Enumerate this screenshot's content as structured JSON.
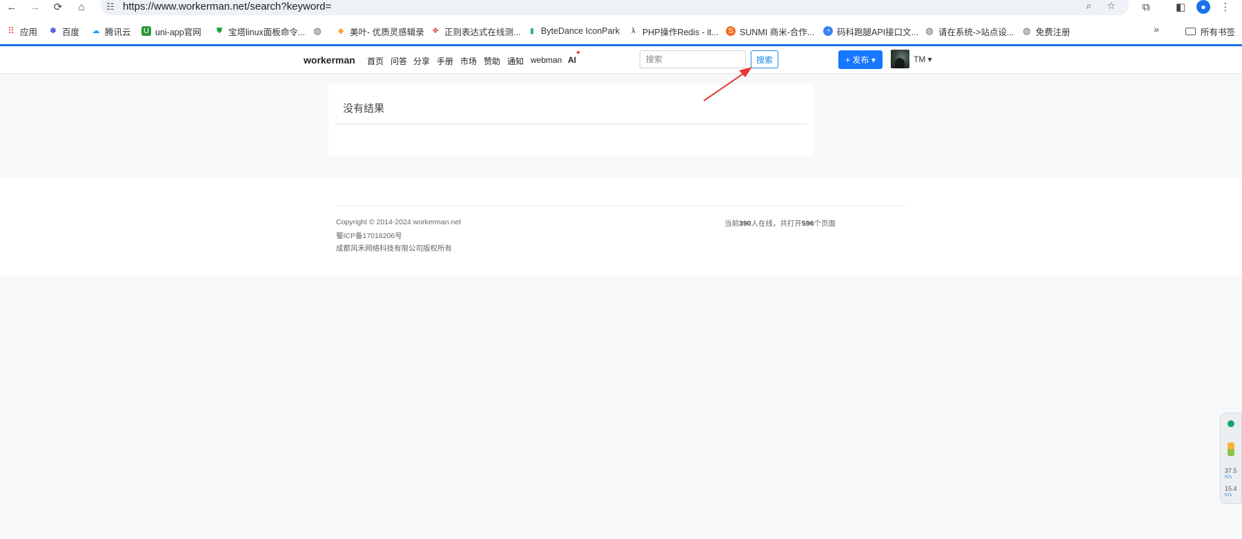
{
  "browser": {
    "url": "https://www.workerman.net/search?keyword=",
    "bookmarks": [
      {
        "label": "应用",
        "icon": "apps-grid-icon",
        "color": "#e8453c"
      },
      {
        "label": "百度",
        "icon": "baidu-paw-icon",
        "color": "#2932e1"
      },
      {
        "label": "腾讯云",
        "icon": "cloud-icon",
        "color": "#00a3ff"
      },
      {
        "label": "uni-app官网",
        "icon": "uni-app-icon",
        "color": "#2b9939"
      },
      {
        "label": "宝塔linux面板命令...",
        "icon": "shield-icon",
        "color": "#20a53a"
      },
      {
        "label": "",
        "icon": "globe-icon",
        "color": "#5f6368"
      },
      {
        "label": "美叶- 优质灵感辑录",
        "icon": "diamond-icon",
        "color": "#f5a623"
      },
      {
        "label": "正则表达式在线测...",
        "icon": "codepen-icon",
        "color": "#e8453c"
      },
      {
        "label": "ByteDance IconPark",
        "icon": "iconpark-icon",
        "color": "#1fb58d"
      },
      {
        "label": "PHP操作Redis - it...",
        "icon": "lambda-icon",
        "color": "#333333"
      },
      {
        "label": "SUNMI 商米-合作...",
        "icon": "sunmi-icon",
        "color": "#f36b21"
      },
      {
        "label": "码科跑腿API接口文...",
        "icon": "maker-icon",
        "color": "#3b82f6"
      },
      {
        "label": "请在系统->站点设...",
        "icon": "globe-icon",
        "color": "#5f6368"
      },
      {
        "label": "免费注册",
        "icon": "globe-icon",
        "color": "#5f6368"
      }
    ],
    "all_bookmarks": "所有书签",
    "more": "»"
  },
  "navbar": {
    "brand": "workerman",
    "links": [
      "首页",
      "问答",
      "分享",
      "手册",
      "市场",
      "赞助",
      "通知",
      "webman",
      "AI"
    ],
    "search_placeholder": "搜索",
    "search_button": "搜索",
    "publish_button": "+ 发布 ▾",
    "user_name": "TM ▾"
  },
  "content": {
    "no_results": "没有结果"
  },
  "footer": {
    "copyright": "Copyright © 2014-2024 workerman.net",
    "icp": "蜀ICP备17016206号",
    "company": "成都风禾网络科技有限公司版权所有",
    "online_prefix": "当前",
    "online_count": "390",
    "online_mid": "人在线，共打开",
    "pages_count": "596",
    "pages_suffix": "个页面"
  },
  "net_widget": {
    "down": "37.5",
    "down_unit": "K/s",
    "up": "15.4",
    "up_unit": "K/s"
  },
  "colors": {
    "accent": "#1677ff",
    "arrow": "#e53935"
  }
}
